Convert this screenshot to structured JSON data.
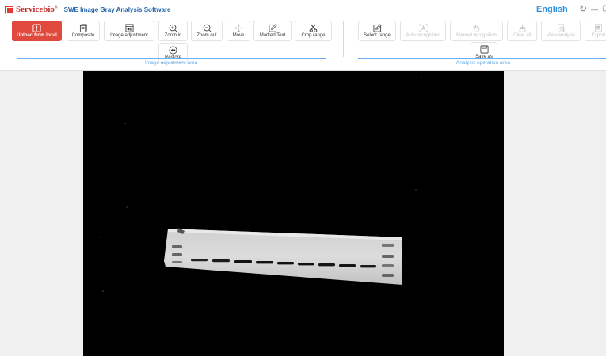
{
  "brand": {
    "name": "Servicebio",
    "reg": "®",
    "title": "SWE Image Gray Analysis Software"
  },
  "window": {
    "language": "English",
    "refresh_glyph": "↻",
    "minimize_glyph": "—",
    "close_glyph": "▢"
  },
  "left_tools": [
    {
      "label": "Upload from local",
      "icon": "upload-icon"
    },
    {
      "label": "Composite",
      "icon": "composite-icon"
    },
    {
      "label": "Image adjustment",
      "icon": "image-adjust-icon"
    },
    {
      "label": "Zoom in",
      "icon": "zoom-in-icon"
    },
    {
      "label": "Zoom out",
      "icon": "zoom-out-icon"
    },
    {
      "label": "Move",
      "icon": "move-icon"
    },
    {
      "label": "Marked Text",
      "icon": "edit-icon"
    },
    {
      "label": "Crop range",
      "icon": "scissors-icon"
    },
    {
      "label": "Restore",
      "icon": "restore-icon"
    }
  ],
  "right_tools": [
    {
      "label": "Select range",
      "icon": "edit-icon",
      "enabled": true
    },
    {
      "label": "Auto recognition",
      "icon": "auto-recognition-icon",
      "enabled": false
    },
    {
      "label": "Manual recognition",
      "icon": "hand-icon",
      "enabled": false
    },
    {
      "label": "Clear all",
      "icon": "broom-icon",
      "enabled": false
    },
    {
      "label": "View analysis",
      "icon": "view-analysis-icon",
      "enabled": false
    },
    {
      "label": "Export",
      "icon": "export-icon",
      "enabled": false
    },
    {
      "label": "Save as",
      "icon": "save-icon",
      "enabled": true
    }
  ],
  "areas": {
    "left": "Image adjustment area",
    "right": "Analysis operation area"
  },
  "colors": {
    "accent": "#2f8fe0",
    "upload_button": "#e04a3c",
    "area_line": "#6ab0f0"
  },
  "canvas": {
    "content": "western blot gel image",
    "band_count": 9
  }
}
